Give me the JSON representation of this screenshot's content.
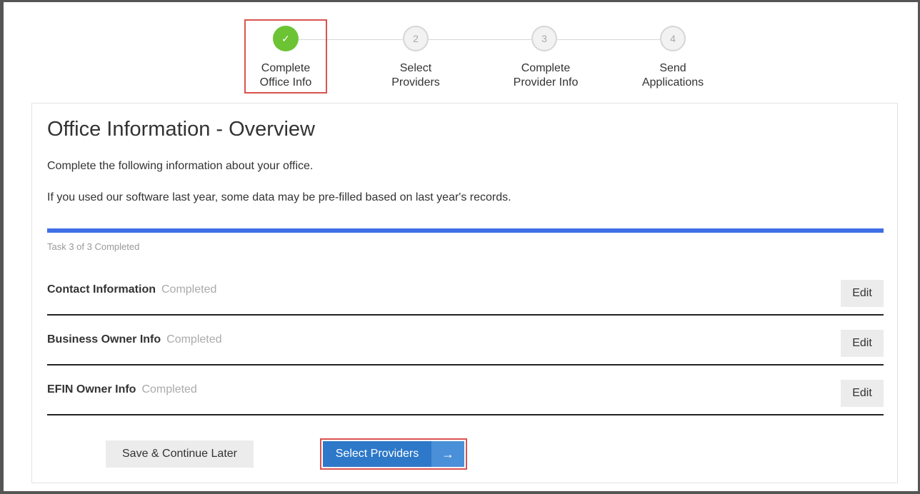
{
  "stepper": {
    "steps": [
      {
        "number": "✓",
        "label": "Complete\nOffice Info",
        "state": "completed"
      },
      {
        "number": "2",
        "label": "Select\nProviders",
        "state": "pending"
      },
      {
        "number": "3",
        "label": "Complete\nProvider Info",
        "state": "pending"
      },
      {
        "number": "4",
        "label": "Send\nApplications",
        "state": "pending"
      }
    ]
  },
  "main": {
    "title": "Office Information - Overview",
    "intro": "Complete the following information about your office.",
    "note": "If you used our software last year, some data may be pre-filled based on last year's records.",
    "progress": {
      "completed": 3,
      "total": 3,
      "label": "Task 3 of 3 Completed",
      "fraction": 1.0
    },
    "sections": [
      {
        "title": "Contact Information",
        "status": "Completed",
        "action": "Edit"
      },
      {
        "title": "Business Owner Info",
        "status": "Completed",
        "action": "Edit"
      },
      {
        "title": "EFIN Owner Info",
        "status": "Completed",
        "action": "Edit"
      }
    ]
  },
  "footer": {
    "save_label": "Save & Continue Later",
    "next_label": "Select Providers",
    "next_icon": "arrow-right-icon",
    "next_arrow_glyph": "→"
  },
  "colors": {
    "accent": "#2d78c8",
    "progress": "#3f6fe6",
    "success": "#6cc334",
    "highlight": "#d9534f"
  }
}
